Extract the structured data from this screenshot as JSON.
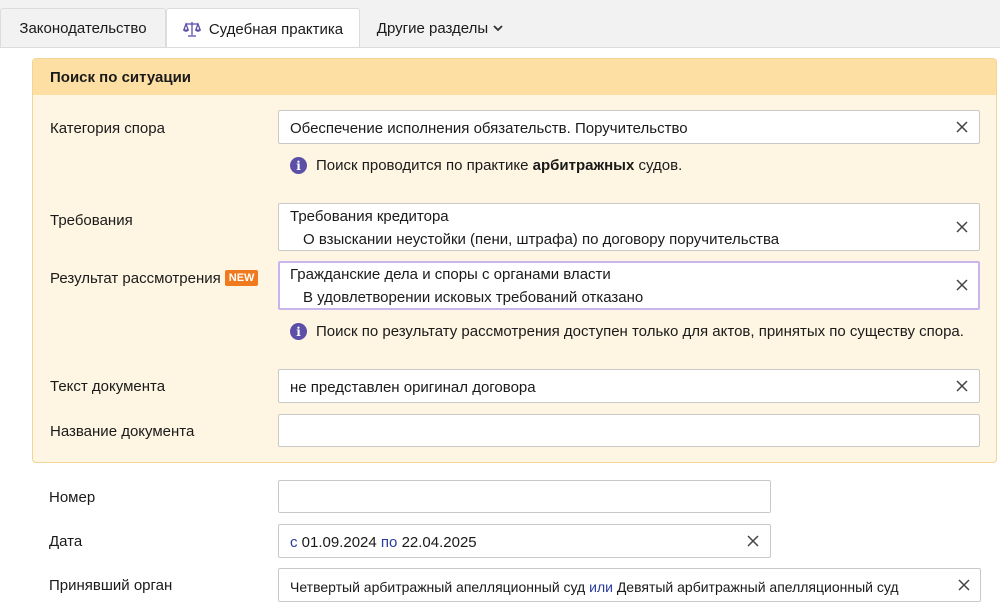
{
  "tabs": [
    {
      "label": "Законодательство"
    },
    {
      "label": "Судебная практика"
    },
    {
      "label": "Другие разделы"
    }
  ],
  "situation": {
    "title": "Поиск по ситуации",
    "category": {
      "label": "Категория спора",
      "value": "Обеспечение исполнения обязательств. Поручительство",
      "note_prefix": "Поиск проводится по практике ",
      "note_bold": "арбитражных",
      "note_suffix": " судов."
    },
    "requirements": {
      "label": "Требования",
      "line1": "Требования кредитора",
      "line2": "О взыскании неустойки (пени, штрафа) по договору поручительства"
    },
    "result": {
      "label": "Результат рассмотрения",
      "badge": "NEW",
      "line1": "Гражданские дела и споры с органами власти",
      "line2": "В удовлетворении исковых требований отказано",
      "note": "Поиск по результату рассмотрения доступен только для актов, принятых по существу спора."
    },
    "doc_text": {
      "label": "Текст документа",
      "value": "не представлен оригинал договора"
    },
    "doc_name": {
      "label": "Название документа",
      "value": ""
    }
  },
  "number": {
    "label": "Номер",
    "value": ""
  },
  "date": {
    "label": "Дата",
    "from_word": "с",
    "from": "01.09.2024",
    "to_word": "по",
    "to": "22.04.2025"
  },
  "authority": {
    "label": "Принявший орган",
    "first": "Четвертый арбитражный апелляционный суд",
    "joiner": "или",
    "second": "Девятый арбитражный апелляционный суд"
  },
  "colors": {
    "accent": "#5b4fa8",
    "badge": "#f07a1e",
    "header": "#fddfa3",
    "section": "#fef6e2",
    "keyword": "#2a3c9e"
  },
  "icons": {
    "judicial_tab": "scales-icon",
    "other_tab": "chevron-down-icon",
    "clear": "close-icon",
    "info": "info-icon"
  }
}
